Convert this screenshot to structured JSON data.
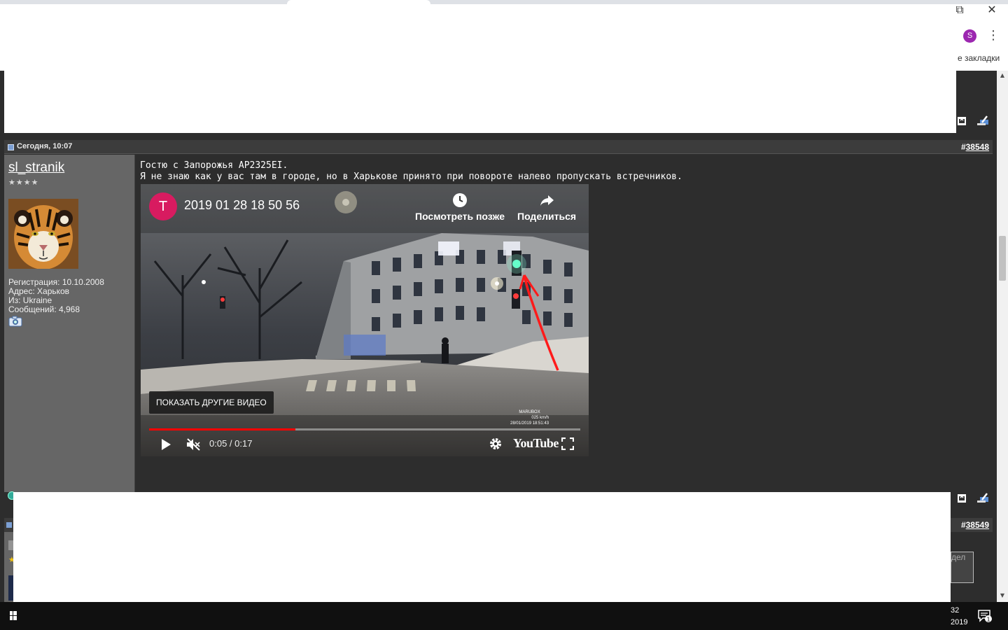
{
  "browser": {
    "restore_icon": "⧉",
    "close_icon": "✕",
    "profile_initial": "S",
    "menu_icon": "⋮",
    "bookmarks_label": "е закладки"
  },
  "post": {
    "date": "Сегодня, 10:07",
    "number_prefix": "#",
    "number": "38548",
    "author": {
      "username": "sl_stranik",
      "rank_stars": "★★★★",
      "info_lines": [
        "Регистрация: 10.10.2008",
        "Адрес: Харьков",
        "Из: Ukraine",
        "Сообщений: 4,968"
      ]
    },
    "message_lines": [
      "Гостю с Запорожья АР2325ЕI.",
      "Я не знаю как у вас там в городе, но в Харькове принято при повороте налево пропускать встречников."
    ],
    "video": {
      "channel_initial": "T",
      "title": "2019 01 28 18 50 56",
      "watch_later": "Посмотреть позже",
      "share": "Поделиться",
      "more_videos": "ПОКАЗАТЬ ДРУГИЕ ВИДЕО",
      "watermark_lines": [
        "MARUBOX",
        "025 km/h",
        "28/01/2019 18:51:43"
      ],
      "time": "0:05 / 0:17",
      "progress": 0.34,
      "logo": "YouTube"
    }
  },
  "next_post": {
    "number_prefix": "#",
    "number": "38549",
    "partial_text": "дел"
  },
  "taskbar": {
    "clock_line1": "32",
    "clock_line2": "2019",
    "notification_count": "1"
  },
  "colors": {
    "page_bg": "#2d2d2d",
    "sidebar_bg": "#666666",
    "header_bg": "#3c3c3c",
    "youtube_red": "#ff0000",
    "avatar_pink": "#d81b60"
  }
}
